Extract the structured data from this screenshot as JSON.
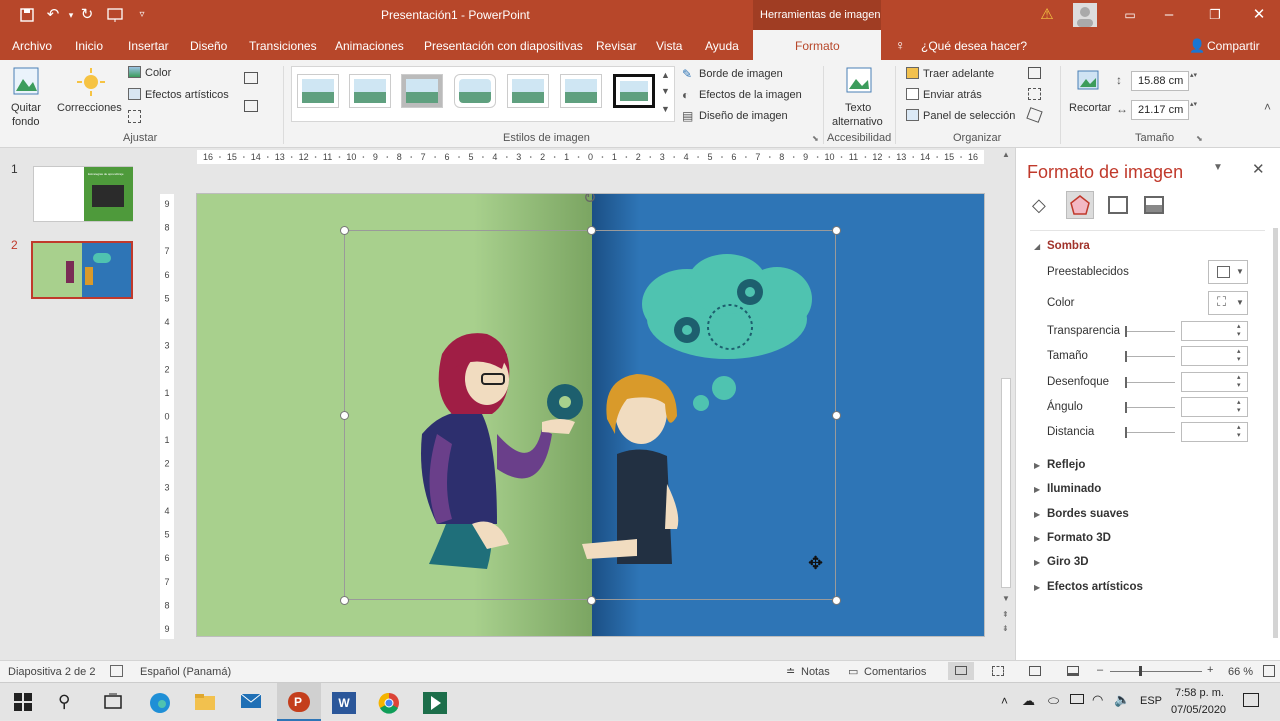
{
  "titlebar": {
    "title": "Presentación1 - PowerPoint",
    "context_title": "Herramientas de imagen"
  },
  "tabs": [
    "Archivo",
    "Inicio",
    "Insertar",
    "Diseño",
    "Transiciones",
    "Animaciones",
    "Presentación con diapositivas",
    "Revisar",
    "Vista",
    "Ayuda",
    "Formato"
  ],
  "tell_me": "¿Qué desea hacer?",
  "share": "Compartir",
  "ribbon": {
    "quitar_fondo_1": "Quitar",
    "quitar_fondo_2": "fondo",
    "correcciones": "Correcciones",
    "color": "Color",
    "efectos_artisticos": "Efectos artísticos",
    "group_ajustar": "Ajustar",
    "group_estilos": "Estilos de imagen",
    "borde": "Borde de imagen",
    "efectos": "Efectos de la imagen",
    "diseno": "Diseño de imagen",
    "texto_alt_1": "Texto",
    "texto_alt_2": "alternativo",
    "group_accesibilidad": "Accesibilidad",
    "traer": "Traer adelante",
    "enviar": "Enviar atrás",
    "panel": "Panel de selección",
    "group_organizar": "Organizar",
    "recortar": "Recortar",
    "height": "15.88 cm",
    "width": "21.17 cm",
    "group_tamano": "Tamaño"
  },
  "ruler": {
    "h_ticks": [
      "16",
      "15",
      "14",
      "13",
      "12",
      "11",
      "10",
      "9",
      "8",
      "7",
      "6",
      "5",
      "4",
      "3",
      "2",
      "1",
      "0",
      "1",
      "2",
      "3",
      "4",
      "5",
      "6",
      "7",
      "8",
      "9",
      "10",
      "11",
      "12",
      "13",
      "14",
      "15",
      "16"
    ],
    "v_ticks": [
      "9",
      "8",
      "7",
      "6",
      "5",
      "4",
      "3",
      "2",
      "1",
      "0",
      "1",
      "2",
      "3",
      "4",
      "5",
      "6",
      "7",
      "8",
      "9"
    ]
  },
  "slides": [
    {
      "num": "1",
      "thumb_text": "Estrategias de aprendizaje"
    },
    {
      "num": "2"
    }
  ],
  "pane": {
    "title": "Formato de imagen",
    "section": "Sombra",
    "rows": [
      "Preestablecidos",
      "Color",
      "Transparencia",
      "Tamaño",
      "Desenfoque",
      "Ángulo",
      "Distancia"
    ],
    "collapsed": [
      "Reflejo",
      "Iluminado",
      "Bordes suaves",
      "Formato 3D",
      "Giro 3D",
      "Efectos artísticos"
    ]
  },
  "status": {
    "slide": "Diapositiva 2 de 2",
    "lang": "Español (Panamá)",
    "notas": "Notas",
    "comentarios": "Comentarios",
    "zoom": "66 %"
  },
  "taskbar": {
    "lang": "ESP",
    "time": "7:58 p. m.",
    "date": "07/05/2020"
  },
  "colors": {
    "accent": "#b7472a",
    "slide_green": "#a8d08d",
    "slide_blue": "#2e75b6",
    "thought_teal": "#4fc3b0"
  },
  "icons": [
    "save-icon",
    "undo-icon",
    "redo-icon",
    "present-icon",
    "customize-icon",
    "warning-icon",
    "user-icon",
    "ribbon-display-icon",
    "minimize-icon",
    "maximize-icon",
    "close-icon",
    "lightbulb-icon",
    "share-icon",
    "fill-icon",
    "effects-icon",
    "layout-icon",
    "picture-icon",
    "windows-icon",
    "search-icon",
    "task-view-icon",
    "edge-icon",
    "explorer-icon",
    "mail-icon",
    "powerpoint-icon",
    "word-icon",
    "chrome-icon",
    "app-icon",
    "notification-icon",
    "volume-icon",
    "wifi-icon",
    "battery-icon",
    "cloud-icon",
    "chevron-up-icon",
    "move-cursor-icon",
    "rotate-icon"
  ]
}
